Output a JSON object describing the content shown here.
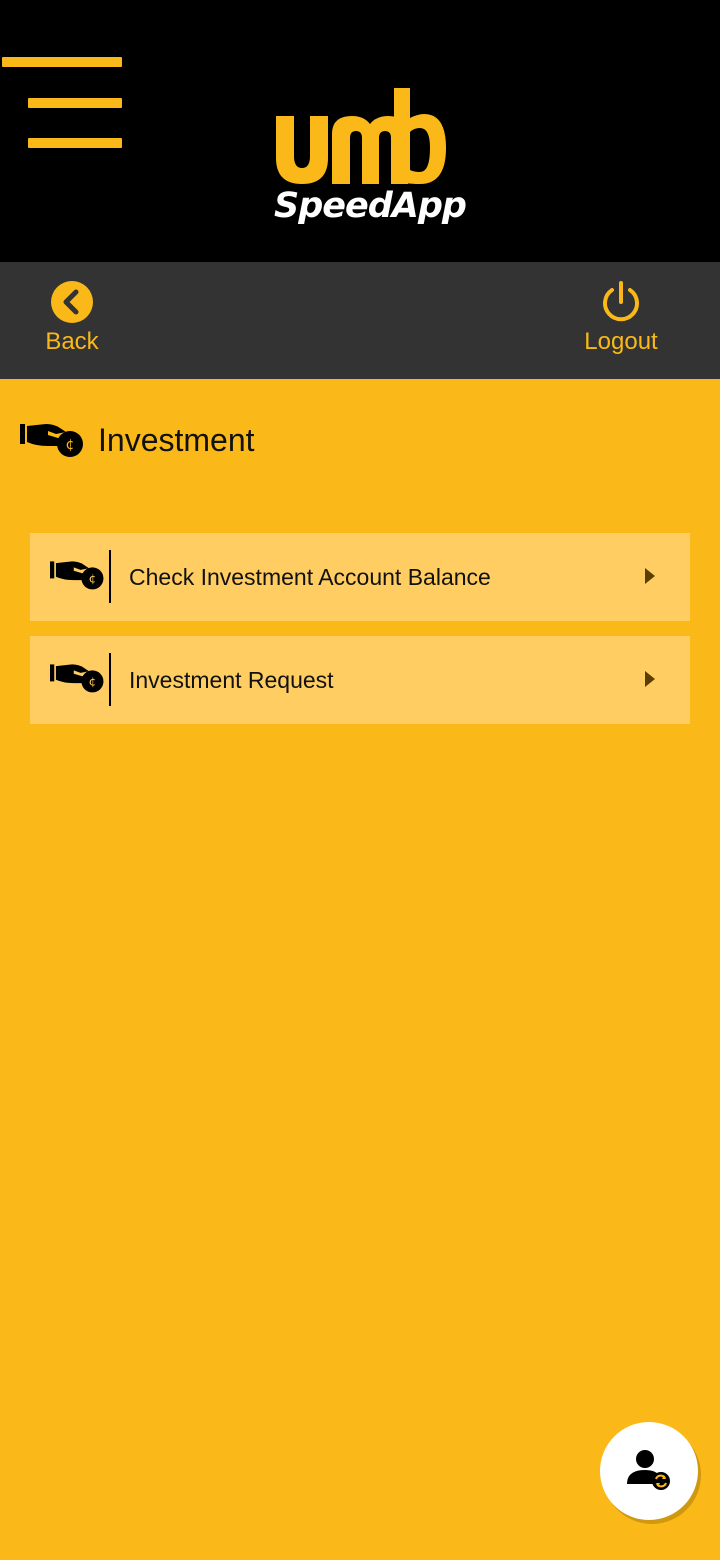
{
  "app": {
    "brand_top": "umb",
    "brand_name": "SpeedApp"
  },
  "colors": {
    "accent": "#FAB918",
    "header_bg": "#000000",
    "toolbar_bg": "#333333",
    "menu_item_bg": "#FFCD62"
  },
  "toolbar": {
    "back_label": "Back",
    "back_icon": "chevron-left-circle-icon",
    "logout_label": "Logout",
    "logout_icon": "power-icon"
  },
  "section": {
    "title": "Investment",
    "icon": "hand-coin-icon"
  },
  "menu": {
    "items": [
      {
        "label": "Check Investment Account Balance",
        "icon": "hand-coin-icon"
      },
      {
        "label": "Investment Request",
        "icon": "hand-coin-icon"
      }
    ]
  },
  "fab": {
    "icon": "user-switch-icon"
  }
}
